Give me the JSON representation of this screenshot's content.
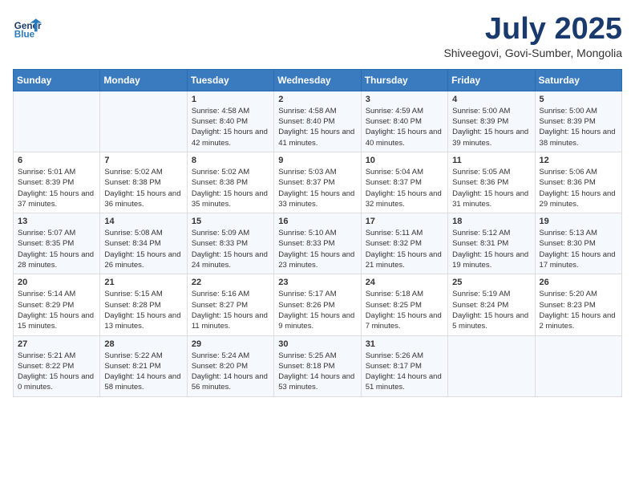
{
  "header": {
    "logo_text_general": "General",
    "logo_text_blue": "Blue",
    "month_title": "July 2025",
    "subtitle": "Shiveegovi, Govi-Sumber, Mongolia"
  },
  "weekdays": [
    "Sunday",
    "Monday",
    "Tuesday",
    "Wednesday",
    "Thursday",
    "Friday",
    "Saturday"
  ],
  "weeks": [
    [
      null,
      null,
      {
        "day": "1",
        "sunrise": "Sunrise: 4:58 AM",
        "sunset": "Sunset: 8:40 PM",
        "daylight": "Daylight: 15 hours and 42 minutes."
      },
      {
        "day": "2",
        "sunrise": "Sunrise: 4:58 AM",
        "sunset": "Sunset: 8:40 PM",
        "daylight": "Daylight: 15 hours and 41 minutes."
      },
      {
        "day": "3",
        "sunrise": "Sunrise: 4:59 AM",
        "sunset": "Sunset: 8:40 PM",
        "daylight": "Daylight: 15 hours and 40 minutes."
      },
      {
        "day": "4",
        "sunrise": "Sunrise: 5:00 AM",
        "sunset": "Sunset: 8:39 PM",
        "daylight": "Daylight: 15 hours and 39 minutes."
      },
      {
        "day": "5",
        "sunrise": "Sunrise: 5:00 AM",
        "sunset": "Sunset: 8:39 PM",
        "daylight": "Daylight: 15 hours and 38 minutes."
      }
    ],
    [
      {
        "day": "6",
        "sunrise": "Sunrise: 5:01 AM",
        "sunset": "Sunset: 8:39 PM",
        "daylight": "Daylight: 15 hours and 37 minutes."
      },
      {
        "day": "7",
        "sunrise": "Sunrise: 5:02 AM",
        "sunset": "Sunset: 8:38 PM",
        "daylight": "Daylight: 15 hours and 36 minutes."
      },
      {
        "day": "8",
        "sunrise": "Sunrise: 5:02 AM",
        "sunset": "Sunset: 8:38 PM",
        "daylight": "Daylight: 15 hours and 35 minutes."
      },
      {
        "day": "9",
        "sunrise": "Sunrise: 5:03 AM",
        "sunset": "Sunset: 8:37 PM",
        "daylight": "Daylight: 15 hours and 33 minutes."
      },
      {
        "day": "10",
        "sunrise": "Sunrise: 5:04 AM",
        "sunset": "Sunset: 8:37 PM",
        "daylight": "Daylight: 15 hours and 32 minutes."
      },
      {
        "day": "11",
        "sunrise": "Sunrise: 5:05 AM",
        "sunset": "Sunset: 8:36 PM",
        "daylight": "Daylight: 15 hours and 31 minutes."
      },
      {
        "day": "12",
        "sunrise": "Sunrise: 5:06 AM",
        "sunset": "Sunset: 8:36 PM",
        "daylight": "Daylight: 15 hours and 29 minutes."
      }
    ],
    [
      {
        "day": "13",
        "sunrise": "Sunrise: 5:07 AM",
        "sunset": "Sunset: 8:35 PM",
        "daylight": "Daylight: 15 hours and 28 minutes."
      },
      {
        "day": "14",
        "sunrise": "Sunrise: 5:08 AM",
        "sunset": "Sunset: 8:34 PM",
        "daylight": "Daylight: 15 hours and 26 minutes."
      },
      {
        "day": "15",
        "sunrise": "Sunrise: 5:09 AM",
        "sunset": "Sunset: 8:33 PM",
        "daylight": "Daylight: 15 hours and 24 minutes."
      },
      {
        "day": "16",
        "sunrise": "Sunrise: 5:10 AM",
        "sunset": "Sunset: 8:33 PM",
        "daylight": "Daylight: 15 hours and 23 minutes."
      },
      {
        "day": "17",
        "sunrise": "Sunrise: 5:11 AM",
        "sunset": "Sunset: 8:32 PM",
        "daylight": "Daylight: 15 hours and 21 minutes."
      },
      {
        "day": "18",
        "sunrise": "Sunrise: 5:12 AM",
        "sunset": "Sunset: 8:31 PM",
        "daylight": "Daylight: 15 hours and 19 minutes."
      },
      {
        "day": "19",
        "sunrise": "Sunrise: 5:13 AM",
        "sunset": "Sunset: 8:30 PM",
        "daylight": "Daylight: 15 hours and 17 minutes."
      }
    ],
    [
      {
        "day": "20",
        "sunrise": "Sunrise: 5:14 AM",
        "sunset": "Sunset: 8:29 PM",
        "daylight": "Daylight: 15 hours and 15 minutes."
      },
      {
        "day": "21",
        "sunrise": "Sunrise: 5:15 AM",
        "sunset": "Sunset: 8:28 PM",
        "daylight": "Daylight: 15 hours and 13 minutes."
      },
      {
        "day": "22",
        "sunrise": "Sunrise: 5:16 AM",
        "sunset": "Sunset: 8:27 PM",
        "daylight": "Daylight: 15 hours and 11 minutes."
      },
      {
        "day": "23",
        "sunrise": "Sunrise: 5:17 AM",
        "sunset": "Sunset: 8:26 PM",
        "daylight": "Daylight: 15 hours and 9 minutes."
      },
      {
        "day": "24",
        "sunrise": "Sunrise: 5:18 AM",
        "sunset": "Sunset: 8:25 PM",
        "daylight": "Daylight: 15 hours and 7 minutes."
      },
      {
        "day": "25",
        "sunrise": "Sunrise: 5:19 AM",
        "sunset": "Sunset: 8:24 PM",
        "daylight": "Daylight: 15 hours and 5 minutes."
      },
      {
        "day": "26",
        "sunrise": "Sunrise: 5:20 AM",
        "sunset": "Sunset: 8:23 PM",
        "daylight": "Daylight: 15 hours and 2 minutes."
      }
    ],
    [
      {
        "day": "27",
        "sunrise": "Sunrise: 5:21 AM",
        "sunset": "Sunset: 8:22 PM",
        "daylight": "Daylight: 15 hours and 0 minutes."
      },
      {
        "day": "28",
        "sunrise": "Sunrise: 5:22 AM",
        "sunset": "Sunset: 8:21 PM",
        "daylight": "Daylight: 14 hours and 58 minutes."
      },
      {
        "day": "29",
        "sunrise": "Sunrise: 5:24 AM",
        "sunset": "Sunset: 8:20 PM",
        "daylight": "Daylight: 14 hours and 56 minutes."
      },
      {
        "day": "30",
        "sunrise": "Sunrise: 5:25 AM",
        "sunset": "Sunset: 8:18 PM",
        "daylight": "Daylight: 14 hours and 53 minutes."
      },
      {
        "day": "31",
        "sunrise": "Sunrise: 5:26 AM",
        "sunset": "Sunset: 8:17 PM",
        "daylight": "Daylight: 14 hours and 51 minutes."
      },
      null,
      null
    ]
  ]
}
